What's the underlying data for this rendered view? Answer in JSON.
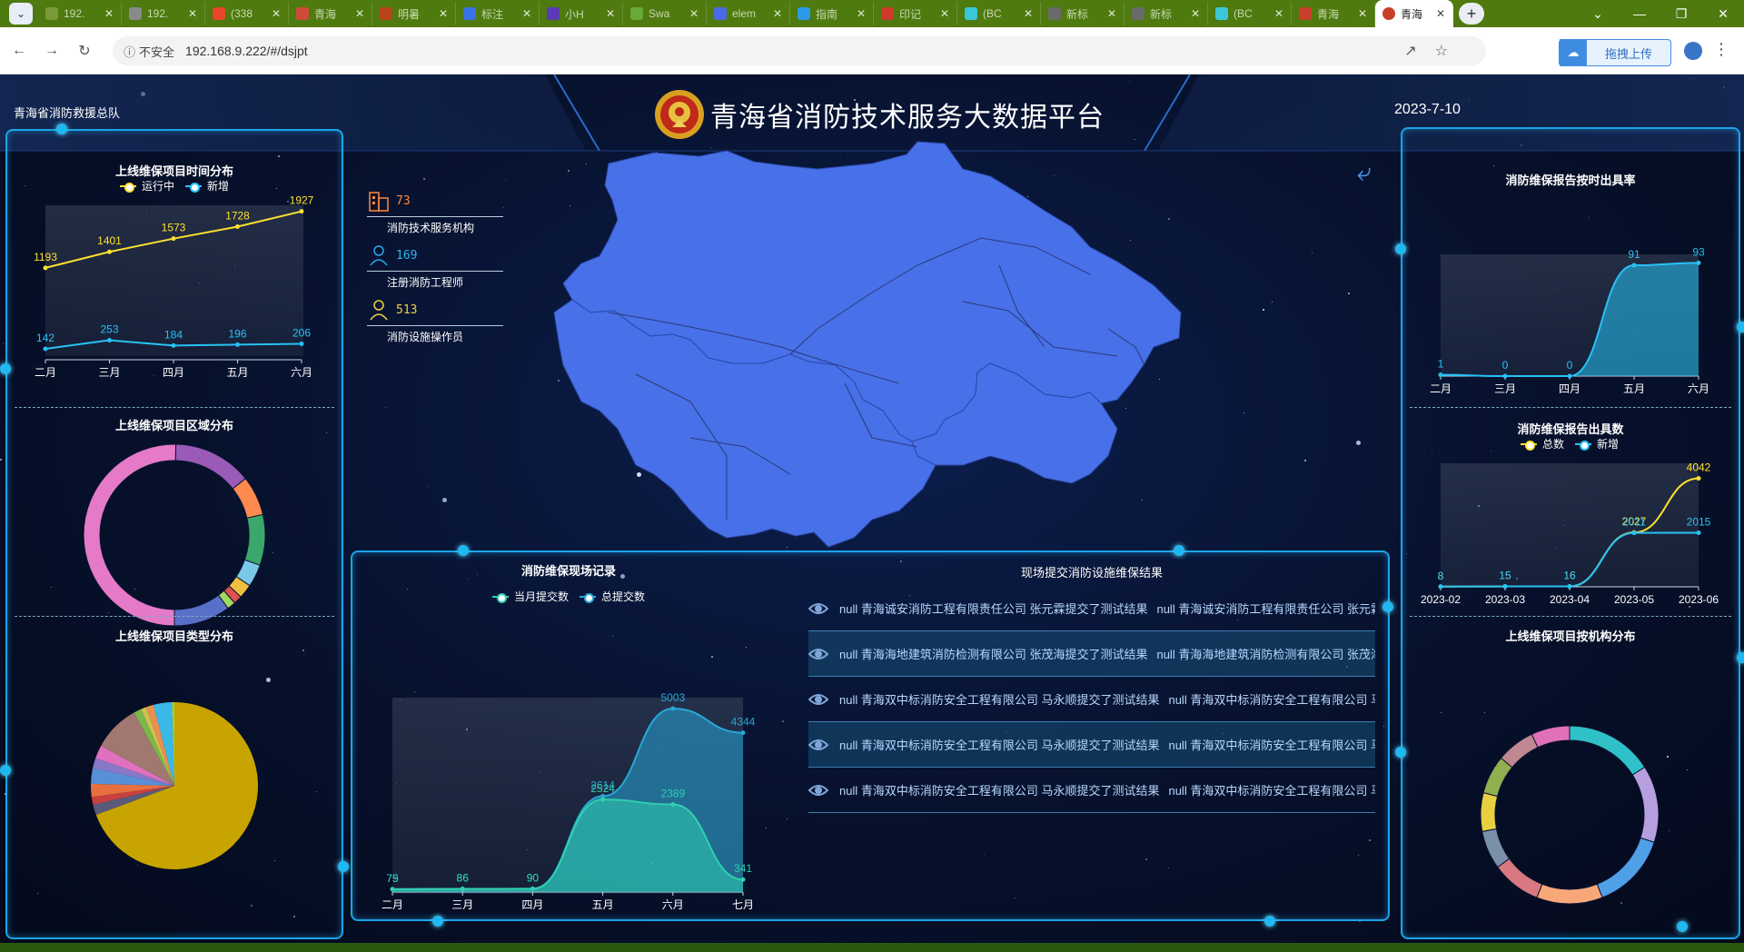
{
  "browser": {
    "tabs": [
      {
        "label": "192.",
        "color": "#7a9a3a"
      },
      {
        "label": "192.",
        "color": "#8a8a8a"
      },
      {
        "label": "(338",
        "color": "#e8462a"
      },
      {
        "label": "青海",
        "color": "#d04a3a"
      },
      {
        "label": "明暑",
        "color": "#b8441a"
      },
      {
        "label": "标注",
        "color": "#3a72e8"
      },
      {
        "label": "小H",
        "color": "#5a3ab8"
      },
      {
        "label": "Swa",
        "color": "#6aa83a"
      },
      {
        "label": "elem",
        "color": "#4a6ae8"
      },
      {
        "label": "指南",
        "color": "#2a9ae8"
      },
      {
        "label": "印记",
        "color": "#d03a2a"
      },
      {
        "label": "(BC",
        "color": "#3ac8d8"
      },
      {
        "label": "新标",
        "color": "#6a6a6a"
      },
      {
        "label": "新标",
        "color": "#6a6a6a"
      },
      {
        "label": "(BC",
        "color": "#3ac8d8"
      },
      {
        "label": "青海",
        "color": "#c8402a"
      }
    ],
    "active_tab": "青海",
    "address": "192.168.9.222/#/dsjpt",
    "security_label": "不安全",
    "upload_label": "拖拽上传"
  },
  "header": {
    "org": "青海省消防救援总队",
    "title": "青海省消防技术服务大数据平台",
    "date": "2023-7-10"
  },
  "stats": [
    {
      "value": "73",
      "label": "消防技术服务机构",
      "icon": "building-icon"
    },
    {
      "value": "169",
      "label": "注册消防工程师",
      "icon": "engineer-icon"
    },
    {
      "value": "513",
      "label": "消防设施操作员",
      "icon": "operator-icon"
    }
  ],
  "left_panel": {
    "time_title": "上线维保项目时间分布",
    "region_title": "上线维保项目区域分布",
    "type_title": "上线维保项目类型分布"
  },
  "right_panel": {
    "rate_title": "消防维保报告按时出具率",
    "count_title": "消防维保报告出具数",
    "org_title": "上线维保项目按机构分布"
  },
  "bottom_panel": {
    "site_title": "消防维保现场记录",
    "feed_title": "现场提交消防设施维保结果",
    "feed": [
      "null 青海诚安消防工程有限责任公司 张元霖提交了测试结果",
      "null 青海海地建筑消防检测有限公司 张茂海提交了测试结果",
      "null 青海双中标消防安全工程有限公司 马永顺提交了测试结果",
      "null 青海双中标消防安全工程有限公司 马永顺提交了测试结果",
      "null 青海双中标消防安全工程有限公司 马永顺提交了测试结果"
    ]
  },
  "chart_data": [
    {
      "type": "line",
      "id": "time-distribution",
      "title": "上线维保项目时间分布",
      "categories": [
        "二月",
        "三月",
        "四月",
        "五月",
        "六月"
      ],
      "series": [
        {
          "name": "运行中",
          "values": [
            1193,
            1401,
            1573,
            1728,
            1927
          ],
          "color": "#ffe030"
        },
        {
          "name": "新增",
          "values": [
            142,
            253,
            184,
            196,
            206
          ],
          "color": "#28c2f5"
        }
      ],
      "ylim": [
        0,
        2100
      ]
    },
    {
      "type": "pie",
      "id": "region-distribution",
      "title": "上线维保项目区域分布",
      "donut": true,
      "slices": [
        {
          "value": 0.5,
          "color": "#e47ac8"
        },
        {
          "value": 0.14,
          "color": "#9a5ab8"
        },
        {
          "value": 0.07,
          "color": "#ff8a50"
        },
        {
          "value": 0.09,
          "color": "#3aa86a"
        },
        {
          "value": 0.04,
          "color": "#7ac8e8"
        },
        {
          "value": 0.025,
          "color": "#f0c040"
        },
        {
          "value": 0.015,
          "color": "#e05050"
        },
        {
          "value": 0.015,
          "color": "#a0d860"
        },
        {
          "value": 0.1,
          "color": "#5870c8"
        }
      ]
    },
    {
      "type": "pie",
      "id": "type-distribution",
      "title": "上线维保项目类型分布",
      "donut": false,
      "slices": [
        {
          "value": 0.69,
          "color": "#c8a400"
        },
        {
          "value": 0.02,
          "color": "#5a5a7a"
        },
        {
          "value": 0.015,
          "color": "#c84040"
        },
        {
          "value": 0.025,
          "color": "#e87040"
        },
        {
          "value": 0.03,
          "color": "#5890d8"
        },
        {
          "value": 0.02,
          "color": "#8878c8"
        },
        {
          "value": 0.025,
          "color": "#e070c0"
        },
        {
          "value": 0.09,
          "color": "#a07870"
        },
        {
          "value": 0.015,
          "color": "#7ab848"
        },
        {
          "value": 0.01,
          "color": "#d0c050"
        },
        {
          "value": 0.015,
          "color": "#e89050"
        },
        {
          "value": 0.035,
          "color": "#3ab8e8"
        },
        {
          "value": 0.005,
          "color": "#9ad050"
        }
      ]
    },
    {
      "type": "area",
      "id": "ontime-rate",
      "title": "消防维保报告按时出具率",
      "categories": [
        "二月",
        "三月",
        "四月",
        "五月",
        "六月"
      ],
      "series": [
        {
          "name": "",
          "values": [
            1,
            0,
            0,
            91,
            93
          ],
          "color": "#28c2f5"
        }
      ],
      "ylim": [
        0,
        100
      ]
    },
    {
      "type": "line",
      "id": "report-count",
      "title": "消防维保报告出具数",
      "categories": [
        "2023-02",
        "2023-03",
        "2023-04",
        "2023-05",
        "2023-06"
      ],
      "series": [
        {
          "name": "总数",
          "values": [
            8,
            15,
            16,
            2027,
            4042
          ],
          "color": "#ffe030"
        },
        {
          "name": "新增",
          "values": [
            8,
            15,
            16,
            2011,
            2015
          ],
          "color": "#28c2f5"
        }
      ],
      "ylim": [
        0,
        4400
      ]
    },
    {
      "type": "pie",
      "id": "org-distribution",
      "title": "上线维保项目按机构分布",
      "donut": true,
      "slices": [
        {
          "value": 0.16,
          "color": "#30c0c8"
        },
        {
          "value": 0.14,
          "color": "#b8a0e0"
        },
        {
          "value": 0.14,
          "color": "#50a0e8"
        },
        {
          "value": 0.12,
          "color": "#f8a878"
        },
        {
          "value": 0.09,
          "color": "#d87880"
        },
        {
          "value": 0.07,
          "color": "#7a90a8"
        },
        {
          "value": 0.07,
          "color": "#e8d040"
        },
        {
          "value": 0.07,
          "color": "#90b050"
        },
        {
          "value": 0.07,
          "color": "#c08890"
        },
        {
          "value": 0.07,
          "color": "#e070b8"
        }
      ]
    },
    {
      "type": "area",
      "id": "site-records",
      "title": "消防维保现场记录",
      "categories": [
        "二月",
        "三月",
        "四月",
        "五月",
        "六月",
        "七月"
      ],
      "series": [
        {
          "name": "总提交数",
          "values": [
            79,
            86,
            90,
            2614,
            5003,
            4344
          ],
          "color": "#28a8d8"
        },
        {
          "name": "当月提交数",
          "values": [
            75,
            86,
            90,
            2524,
            2389,
            341
          ],
          "color": "#30d0b0"
        }
      ],
      "ylim": [
        0,
        5300
      ]
    }
  ]
}
